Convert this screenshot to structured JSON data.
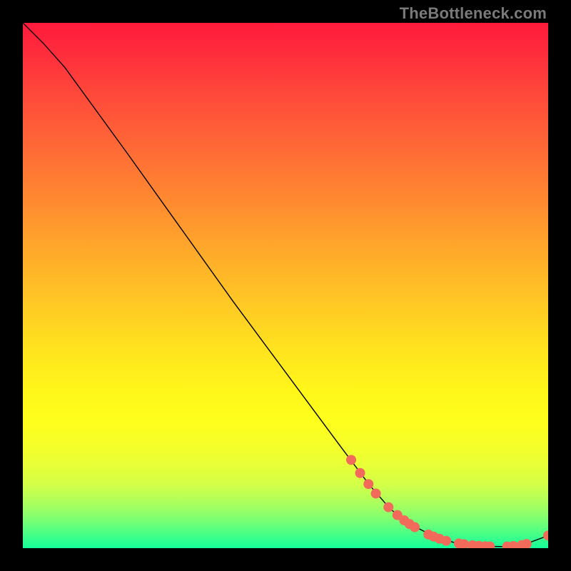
{
  "watermark": "TheBottleneck.com",
  "chart_data": {
    "type": "line",
    "title": "",
    "xlabel": "",
    "ylabel": "",
    "xlim": [
      0,
      100
    ],
    "ylim": [
      0,
      100
    ],
    "grid": false,
    "legend": false,
    "series": [
      {
        "name": "curve",
        "color": "#000000",
        "x": [
          0,
          4,
          8,
          12,
          20,
          30,
          40,
          50,
          60,
          66,
          70,
          74,
          78,
          82,
          86,
          88,
          92,
          96,
          100
        ],
        "y": [
          100,
          96,
          91.5,
          86,
          75,
          61,
          47,
          33.5,
          20,
          12,
          7.4,
          4.4,
          2.4,
          1.1,
          0.45,
          0.34,
          0.3,
          0.9,
          2.4
        ]
      }
    ],
    "markers": {
      "color": "#f26a5a",
      "radius_px": 7,
      "points": [
        {
          "x": 62.5,
          "y": 16.8
        },
        {
          "x": 64.2,
          "y": 14.3
        },
        {
          "x": 65.8,
          "y": 12.2
        },
        {
          "x": 67.2,
          "y": 10.4
        },
        {
          "x": 69.6,
          "y": 7.8
        },
        {
          "x": 71.3,
          "y": 6.3
        },
        {
          "x": 72.6,
          "y": 5.3
        },
        {
          "x": 73.6,
          "y": 4.6
        },
        {
          "x": 74.6,
          "y": 4.0
        },
        {
          "x": 77.2,
          "y": 2.6
        },
        {
          "x": 78.2,
          "y": 2.2
        },
        {
          "x": 79.3,
          "y": 1.8
        },
        {
          "x": 80.6,
          "y": 1.4
        },
        {
          "x": 83.0,
          "y": 0.9
        },
        {
          "x": 84.0,
          "y": 0.75
        },
        {
          "x": 85.6,
          "y": 0.55
        },
        {
          "x": 86.8,
          "y": 0.45
        },
        {
          "x": 88.0,
          "y": 0.36
        },
        {
          "x": 88.9,
          "y": 0.33
        },
        {
          "x": 92.2,
          "y": 0.32
        },
        {
          "x": 93.4,
          "y": 0.4
        },
        {
          "x": 95.0,
          "y": 0.6
        },
        {
          "x": 95.9,
          "y": 0.8
        },
        {
          "x": 100.0,
          "y": 2.4
        }
      ]
    }
  }
}
